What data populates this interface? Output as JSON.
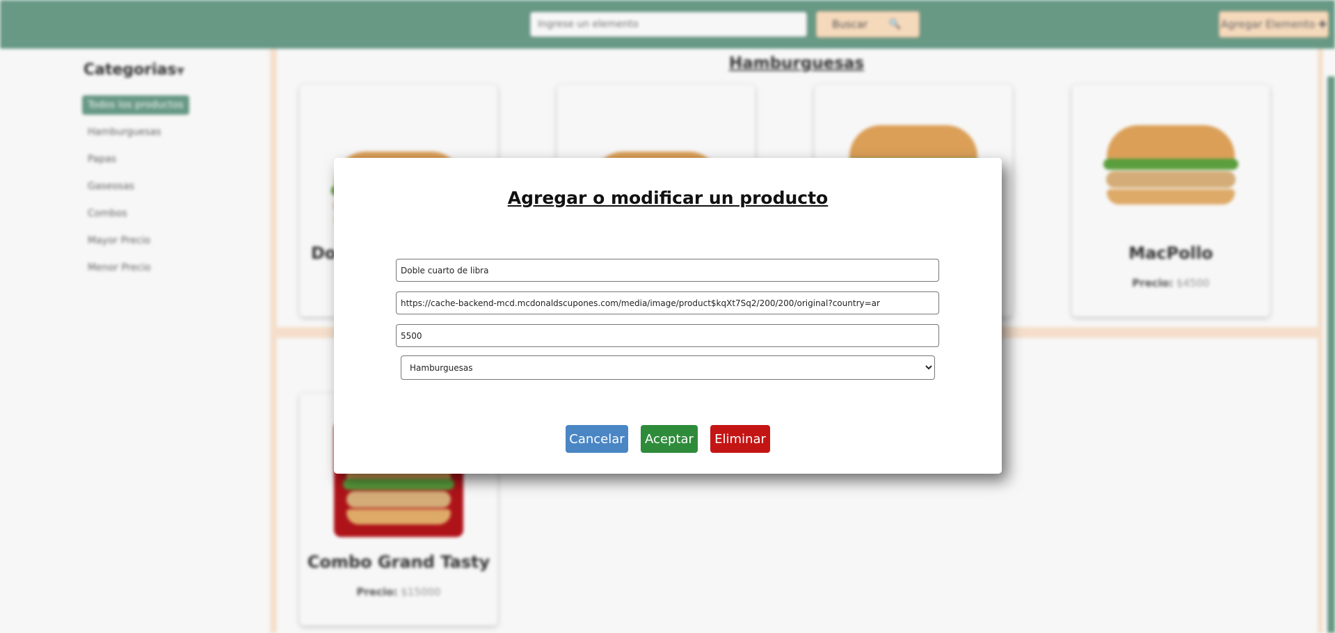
{
  "topbar": {
    "search_placeholder": "Ingrese un elemento",
    "search_button_label": "Buscar",
    "search_icon": "🔍",
    "add_button_label": "Agregar Elemento",
    "add_icon": "✚"
  },
  "sidebar": {
    "title": "Categorias",
    "title_icon": "▼",
    "items": [
      {
        "label": "Todos los productos",
        "active": true
      },
      {
        "label": "Hamburguesas"
      },
      {
        "label": "Papas"
      },
      {
        "label": "Gaseosas"
      },
      {
        "label": "Combos"
      },
      {
        "label": "Mayor Precio"
      },
      {
        "label": "Menor Precio"
      }
    ]
  },
  "section": {
    "title": "Hamburguesas"
  },
  "cards": [
    {
      "name": "Do",
      "price_label": "",
      "price": ""
    },
    {
      "name": "",
      "price_label": "",
      "price": ""
    },
    {
      "name": "",
      "price_label": "",
      "price": ""
    },
    {
      "name": "MacPollo",
      "price_label": "Precio:",
      "price": "$4500"
    },
    {
      "name": "Combo Grand Tasty",
      "price_label": "Precio:",
      "price": "$15000"
    }
  ],
  "modal": {
    "title": "Agregar o modificar un producto",
    "name_value": "Doble cuarto de libra",
    "url_value": "https://cache-backend-mcd.mcdonaldscupones.com/media/image/product$kqXt7Sq2/200/200/original?country=ar",
    "price_value": "5500",
    "category_selected": "Hamburguesas",
    "cancel_label": "Cancelar",
    "accept_label": "Aceptar",
    "delete_label": "Eliminar"
  },
  "colors": {
    "brand_green": "#6b9e8a",
    "peach": "#fde0c2",
    "cancel": "#4a86c4",
    "accept": "#2e8b3a",
    "delete": "#c41515"
  }
}
